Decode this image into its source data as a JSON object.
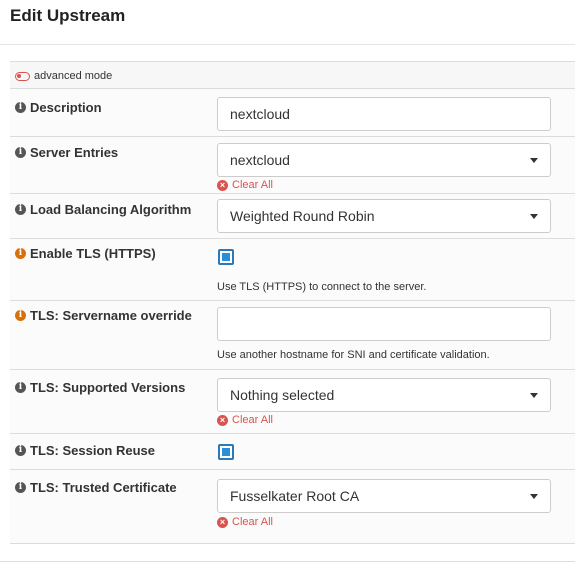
{
  "dialog": {
    "title": "Edit Upstream"
  },
  "advanced_mode": {
    "label": "advanced mode"
  },
  "fields": {
    "description": {
      "label": "Description",
      "value": "nextcloud"
    },
    "server_entries": {
      "label": "Server Entries",
      "value": "nextcloud",
      "clear_label": "Clear All"
    },
    "load_balancing": {
      "label": "Load Balancing Algorithm",
      "value": "Weighted Round Robin"
    },
    "enable_tls": {
      "label": "Enable TLS (HTTPS)",
      "checked": true,
      "help": "Use TLS (HTTPS) to connect to the server."
    },
    "tls_servername": {
      "label": "TLS: Servername override",
      "value": "",
      "help": "Use another hostname for SNI and certificate validation."
    },
    "tls_versions": {
      "label": "TLS: Supported Versions",
      "value": "Nothing selected",
      "clear_label": "Clear All"
    },
    "tls_session_reuse": {
      "label": "TLS: Session Reuse",
      "checked": true
    },
    "tls_trusted_cert": {
      "label": "TLS: Trusted Certificate",
      "value": "Fusselkater Root CA",
      "clear_label": "Clear All"
    }
  },
  "icons": {
    "info": "info-icon",
    "clear": "times-circle-icon",
    "dropdown": "caret-down-icon"
  },
  "colors": {
    "accent": "#2a8fd6",
    "danger": "#d9534f",
    "warning": "#d9710b"
  }
}
